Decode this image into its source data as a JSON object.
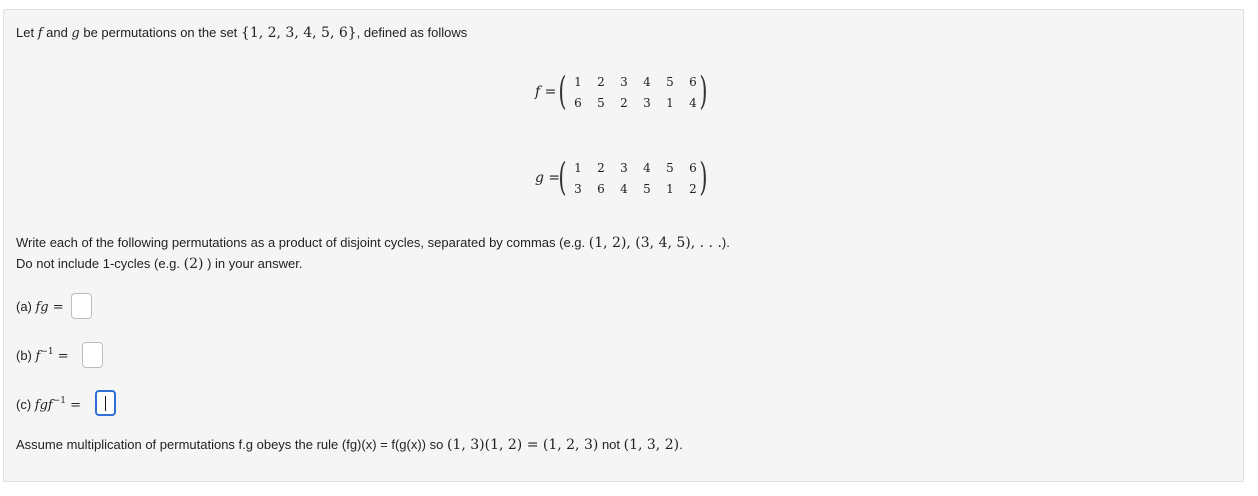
{
  "intro": {
    "text_before_f": "Let ",
    "f": "f",
    "and": " and ",
    "g": "g",
    "text_after_g": " be permutations on the set ",
    "set": "{1, 2, 3, 4, 5, 6}",
    "text_end": ", defined as follows"
  },
  "permutation_f": {
    "lhs": "f =",
    "top": [
      "1",
      "2",
      "3",
      "4",
      "5",
      "6"
    ],
    "bottom": [
      "6",
      "5",
      "2",
      "3",
      "1",
      "4"
    ]
  },
  "permutation_g": {
    "lhs": "g =",
    "top": [
      "1",
      "2",
      "3",
      "4",
      "5",
      "6"
    ],
    "bottom": [
      "3",
      "6",
      "4",
      "5",
      "1",
      "2"
    ]
  },
  "instructions": {
    "line1_text": "Write each of the following permutations as a product of disjoint cycles, separated by commas (e.g. ",
    "line1_math": "(1, 2), (3, 4, 5), . . .",
    "line1_end": ").",
    "line2_text": "Do not include 1-cycles (e.g. ",
    "line2_math": "(2)",
    "line2_end": " ) in your answer."
  },
  "parts": {
    "a": {
      "label": "(a) ",
      "expr": "fg",
      "eq": " ="
    },
    "b": {
      "label": "(b) ",
      "base": "f",
      "exp": "−1",
      "eq": " ="
    },
    "c": {
      "label": "(c) ",
      "base": "fgf",
      "exp": "−1",
      "eq": " ="
    }
  },
  "footer": {
    "text": "Assume multiplication of permutations f.g obeys the rule (fg)(x) = f(g(x)) so ",
    "math1": "(1, 3)(1, 2) = (1, 2, 3)",
    "not": " not ",
    "math2": "(1, 3, 2)",
    "end": "."
  },
  "colors": {
    "panel_bg": "#f5f5f5",
    "active_border": "#2f6fd6"
  }
}
